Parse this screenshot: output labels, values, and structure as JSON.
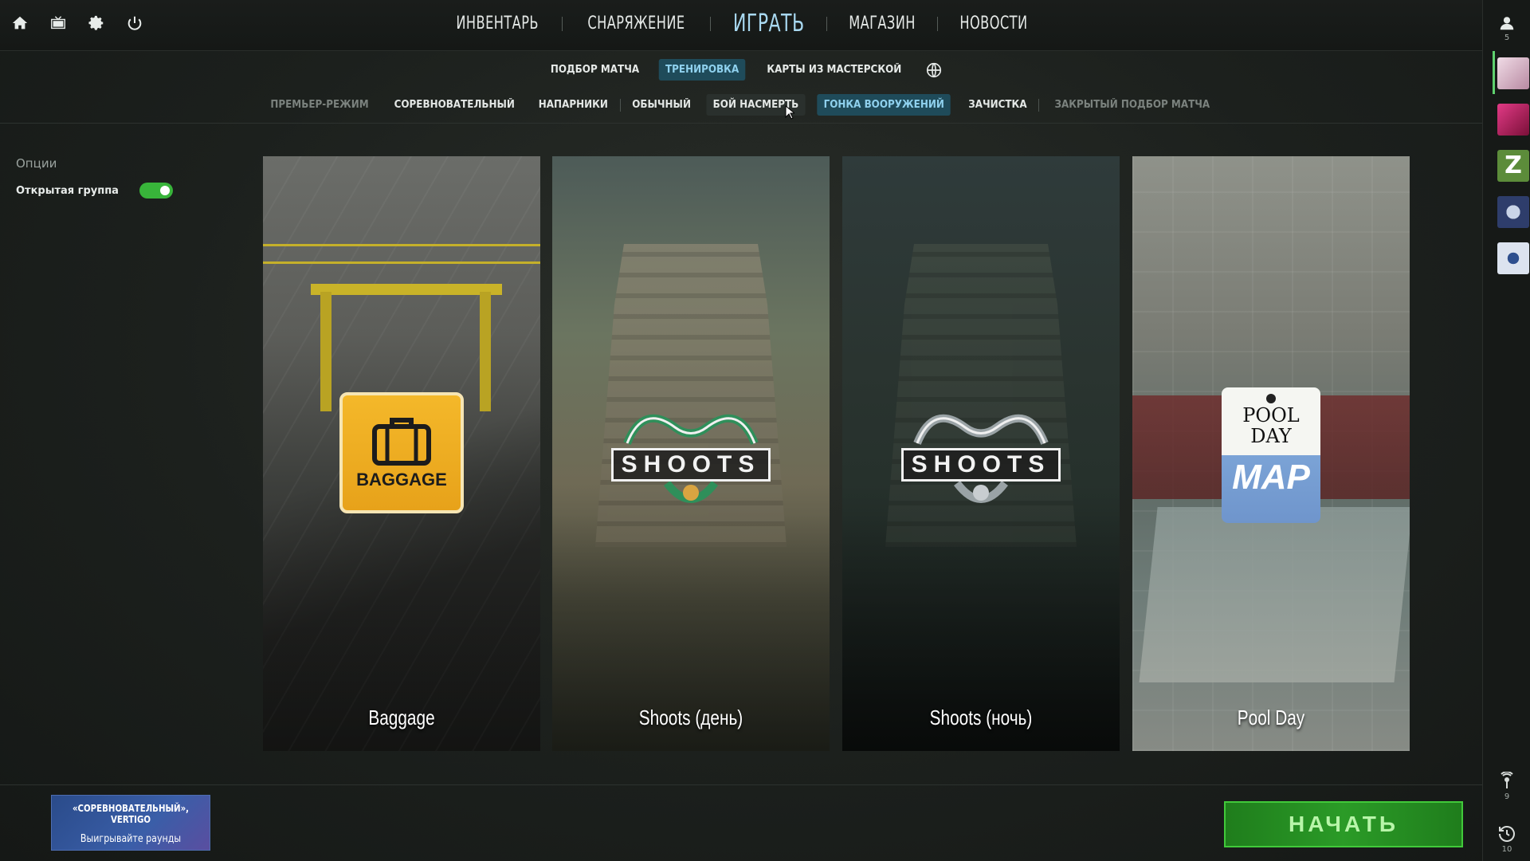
{
  "top_icons": [
    "home-icon",
    "tv-icon",
    "gear-icon",
    "power-icon"
  ],
  "main_nav": {
    "items": [
      {
        "label": "ИНВЕНТАРЬ"
      },
      {
        "label": "СНАРЯЖЕНИЕ"
      },
      {
        "label": "ИГРАТЬ",
        "active": true
      },
      {
        "label": "МАГАЗИН"
      },
      {
        "label": "НОВОСТИ"
      }
    ]
  },
  "sub_nav": {
    "items": [
      {
        "label": "ПОДБОР МАТЧА"
      },
      {
        "label": "ТРЕНИРОВКА",
        "active": true
      },
      {
        "label": "КАРТЫ ИЗ МАСТЕРСКОЙ"
      }
    ],
    "globe_icon": "globe-icon"
  },
  "mode_nav": {
    "items": [
      {
        "label": "ПРЕМЬЕР-РЕЖИМ",
        "dim": true
      },
      {
        "label": "СОРЕВНОВАТЕЛЬНЫЙ"
      },
      {
        "label": "НАПАРНИКИ"
      },
      {
        "label": "ОБЫЧНЫЙ"
      },
      {
        "label": "БОЙ НАСМЕРТЬ"
      },
      {
        "label": "ГОНКА ВООРУЖЕНИЙ",
        "active": true
      },
      {
        "label": "ЗАЧИСТКА"
      },
      {
        "label": "ЗАКРЫТЫЙ ПОДБОР МАТЧА",
        "dim": true
      }
    ]
  },
  "options": {
    "title": "Опции",
    "open_party_label": "Открытая группа",
    "open_party_enabled": true
  },
  "maps": [
    {
      "name": "Baggage",
      "badge": "BAGGAGE",
      "selected": true
    },
    {
      "name": "Shoots (день)",
      "badge": "SHOOTS"
    },
    {
      "name": "Shoots (ночь)",
      "badge": "SHOOTS"
    },
    {
      "name": "Pool Day",
      "badge_top": "POOL DAY",
      "badge_bottom": "MAP"
    }
  ],
  "mission": {
    "line1": "«СОРЕВНОВАТЕЛЬНЫЙ», VERTIGO",
    "line2": "Выигрывайте раунды"
  },
  "start_button": "НАЧАТЬ",
  "right_bar": {
    "profile_count": "5",
    "friends": [
      {
        "color": "#d9b8c8",
        "online": true
      },
      {
        "color": "#c0256a"
      },
      {
        "color": "#5c8c3a",
        "glyph": "Z"
      },
      {
        "color": "#2e3d6b"
      },
      {
        "color": "#dce3ef"
      }
    ],
    "signal_count": "9",
    "history_count": "10"
  },
  "colors": {
    "accent_active_bg": "#1f4b5a",
    "accent_active_text": "#8fd1ee",
    "start_green": "#2b9b27",
    "toggle_green": "#38b43a"
  }
}
